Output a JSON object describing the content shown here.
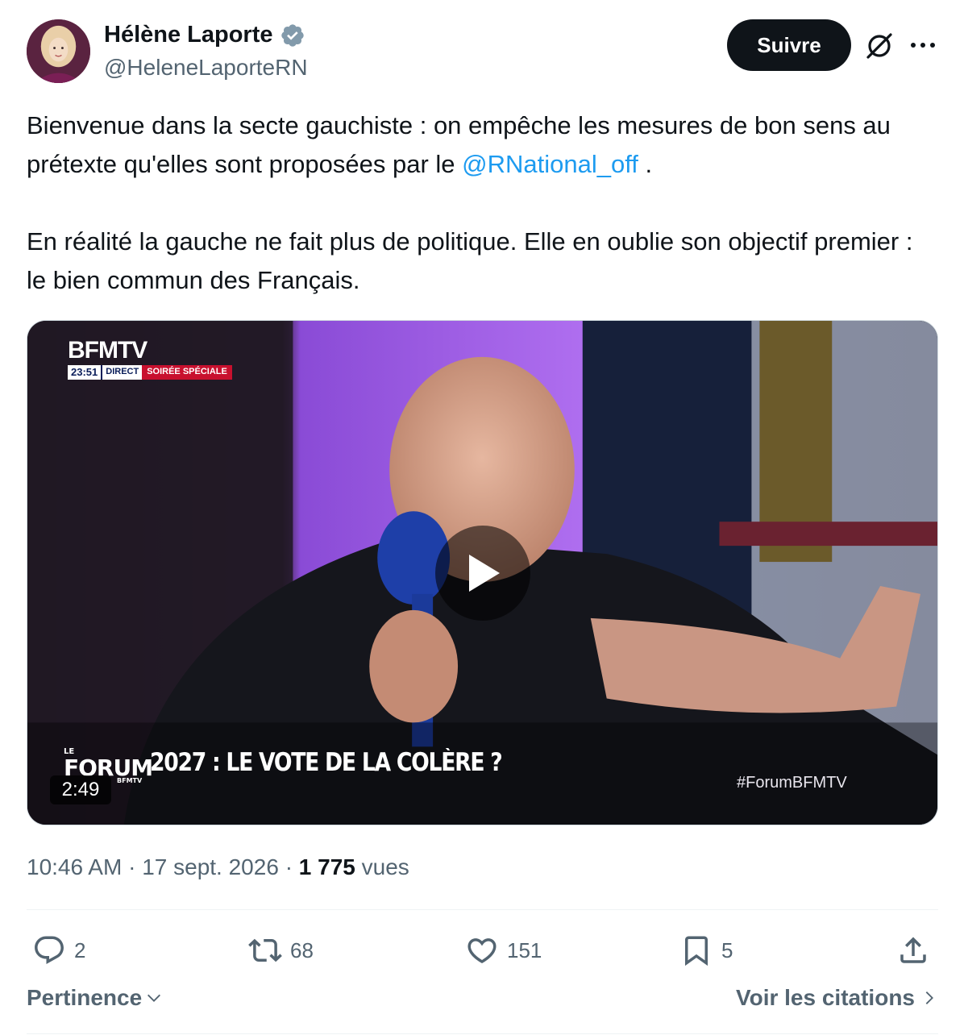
{
  "author": {
    "name": "Hélène Laporte",
    "handle": "@HeleneLaporteRN",
    "verified": true
  },
  "header": {
    "follow_label": "Suivre",
    "icons": [
      "grok-icon",
      "more-icon"
    ]
  },
  "tweet": {
    "line1_text": "Bienvenue dans la secte gauchiste : on empêche les mesures de bon sens au prétexte qu'elles sont proposées par le ",
    "mention": "@RNational_off",
    "line1_end": " .",
    "paragraph2": "En réalité la gauche ne fait plus de politique. Elle en oublie son objectif premier : le bien commun des Français."
  },
  "media": {
    "channel_logo": "BFMTV",
    "clock": "23:51",
    "live_label": "DIRECT",
    "program_label": "SOIRÉE SPÉCIALE",
    "forum_le": "LE",
    "forum_word": "FORUM",
    "forum_sub": "BFMTV",
    "headline": "2027 : LE VOTE DE LA COLÈRE ?",
    "hashtag": "#ForumBFMTV",
    "duration": "2:49"
  },
  "meta": {
    "time": "10:46 AM",
    "date": "17 sept. 2026",
    "views_count": "1 775",
    "views_label": "vues"
  },
  "actions": {
    "replies": "2",
    "reposts": "68",
    "likes": "151",
    "bookmarks": "5"
  },
  "footer": {
    "sort_label": "Pertinence",
    "quotes_label": "Voir les citations"
  },
  "colors": {
    "accent": "#1d9bf0",
    "text": "#0f1419",
    "secondary": "#536471",
    "follow_bg": "#0f1419",
    "bfm_red": "#c8102e"
  }
}
